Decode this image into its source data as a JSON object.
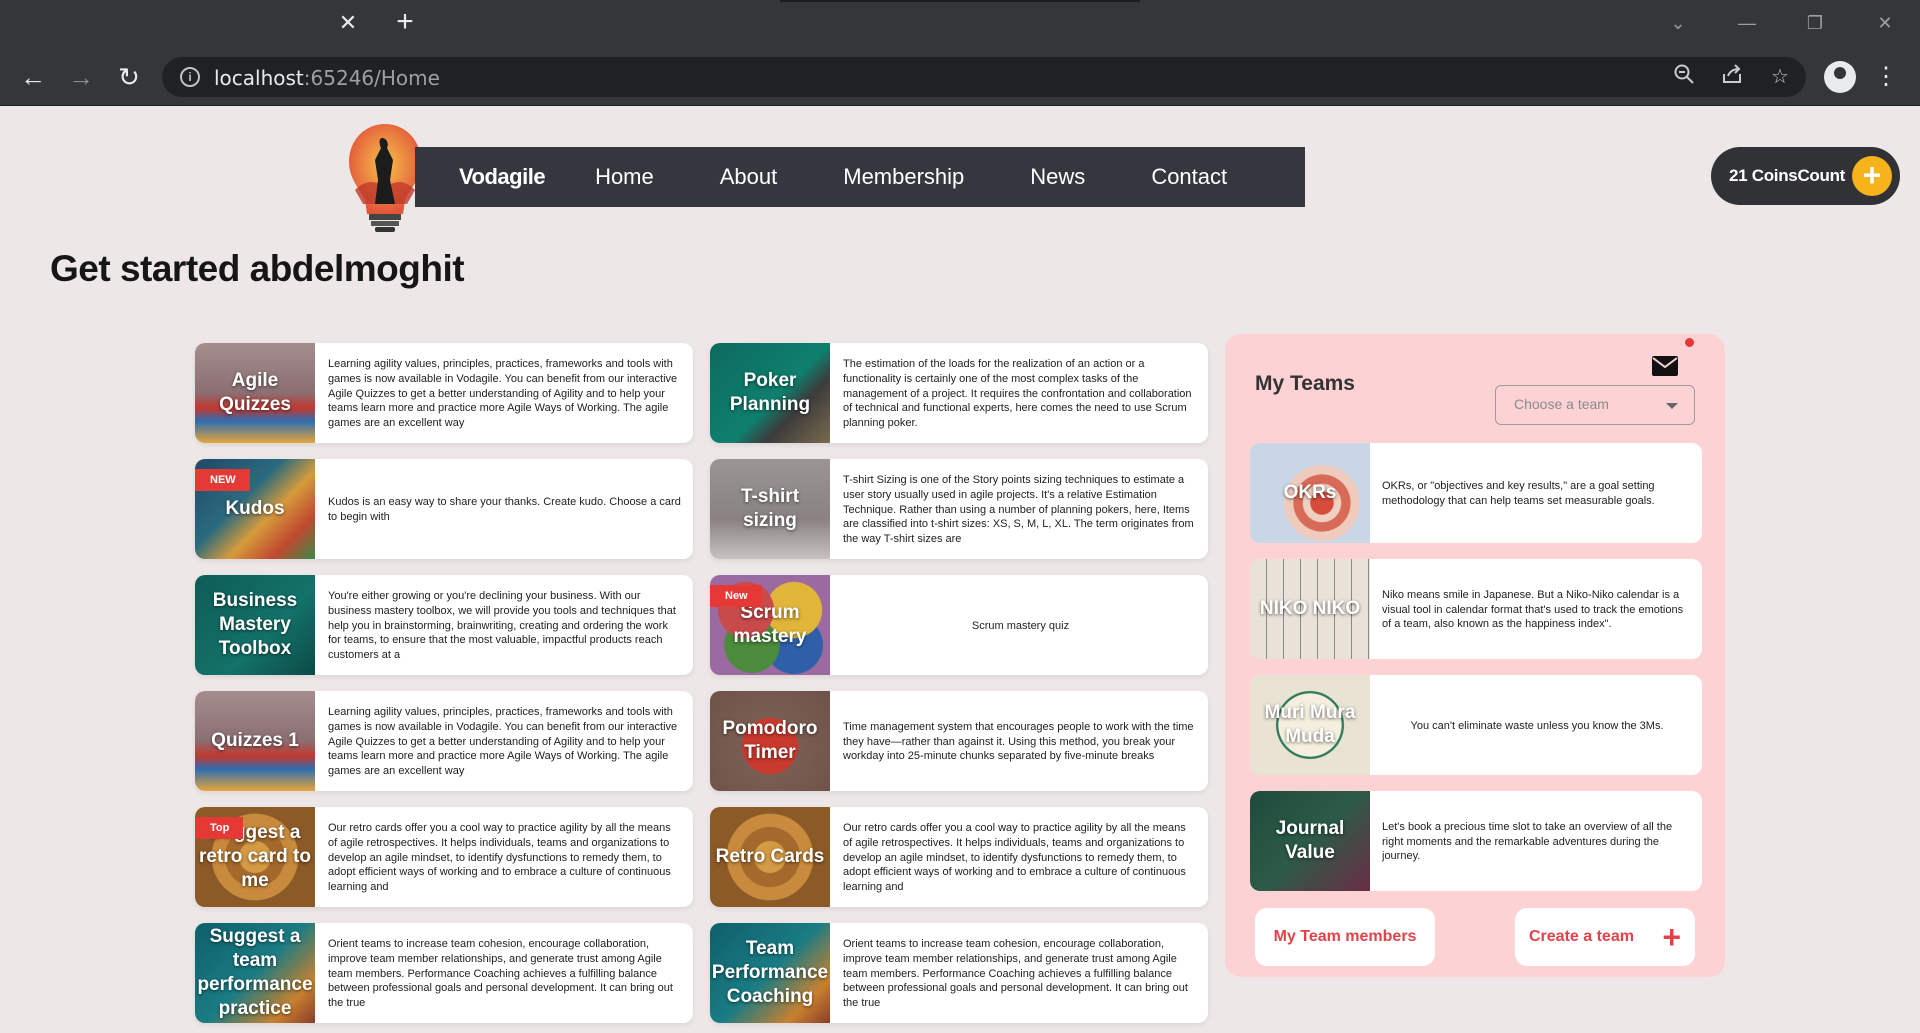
{
  "browser": {
    "url_host": "localhost",
    "url_rest": ":65246/Home",
    "tab_close": "✕",
    "tab_new": "+"
  },
  "nav": {
    "brand": "Vodagile",
    "links": [
      "Home",
      "About",
      "Membership",
      "News",
      "Contact"
    ]
  },
  "coins": {
    "label": "21 CoinsCount",
    "plus": "+"
  },
  "greeting": "Get started abdelmoghit",
  "cards": [
    {
      "title": "Agile Quizzes",
      "desc": "Learning agility values, principles, practices, frameworks and tools with games is now available in Vodagile. You can benefit from our interactive Agile Quizzes to get a better understanding of Agility and to help your teams learn more and practice more Agile Ways of Working. The agile games are an excellent way",
      "badge": ""
    },
    {
      "title": "Poker Planning",
      "desc": "The estimation of the loads for the realization of an action or a functionality is certainly one of the most complex tasks of the management of a project. It requires the confrontation and collaboration of technical and functional experts, here comes the need to use Scrum planning poker.",
      "badge": ""
    },
    {
      "title": "Kudos",
      "desc": "Kudos is an easy way to share your thanks. Create kudo. Choose a card to begin with",
      "badge": "NEW"
    },
    {
      "title": "T-shirt sizing",
      "desc": "T-shirt Sizing is one of the Story points sizing techniques to estimate a user story usually used in agile projects. It's a relative Estimation Technique. Rather than using a number of planning pokers, here, Items are classified into t-shirt sizes: XS, S, M, L, XL. The term originates from the way T-shirt sizes are",
      "badge": ""
    },
    {
      "title": "Business Mastery Toolbox",
      "desc": "You're either growing or you're declining your business. With our business mastery toolbox, we will provide you tools and techniques that help you in brainstorming, brainwriting, creating and ordering the work for teams, to ensure that the most valuable, impactful products reach customers at a",
      "badge": ""
    },
    {
      "title": "Scrum mastery",
      "desc": "Scrum mastery quiz",
      "badge": "New"
    },
    {
      "title": "Quizzes 1",
      "desc": "Learning agility values, principles, practices, frameworks and tools with games is now available in Vodagile. You can benefit from our interactive Agile Quizzes to get a better understanding of Agility and to help your teams learn more and practice more Agile Ways of Working. The agile games are an excellent way",
      "badge": ""
    },
    {
      "title": "Pomodoro Timer",
      "desc": "Time management system that encourages people to work with the time they have—rather than against it. Using this method, you break your workday into 25-minute chunks separated by five-minute breaks",
      "badge": ""
    },
    {
      "title": "Suggest a retro card to me",
      "desc": "Our retro cards offer you a cool way to practice agility by all the means of agile retrospectives. It helps individuals, teams and organizations to develop an agile mindset, to identify dysfunctions to remedy them, to adopt efficient ways of working and to embrace a culture of continuous learning and",
      "badge": "Top"
    },
    {
      "title": "Retro Cards",
      "desc": "Our retro cards offer you a cool way to practice agility by all the means of agile retrospectives. It helps individuals, teams and organizations to develop an agile mindset, to identify dysfunctions to remedy them, to adopt efficient ways of working and to embrace a culture of continuous learning and",
      "badge": ""
    },
    {
      "title": "Suggest a team performance practice",
      "desc": "Orient teams to increase team cohesion, encourage collaboration, improve team member relationships, and generate trust among Agile team members. Performance Coaching achieves a fulfilling balance between professional goals and personal development. It can bring out the true",
      "badge": ""
    },
    {
      "title": "Team Performance Coaching",
      "desc": "Orient teams to increase team cohesion, encourage collaboration, improve team member relationships, and generate trust among Agile team members. Performance Coaching achieves a fulfilling balance between professional goals and personal development. It can bring out the true",
      "badge": ""
    }
  ],
  "teams": {
    "title": "My Teams",
    "select_placeholder": "Choose a team",
    "items": [
      {
        "title": "OKRs",
        "desc": "OKRs, or \"objectives and key results,\" are a goal setting methodology that can help teams set measurable goals."
      },
      {
        "title": "NIKO NIKO",
        "desc": "Niko means smile in Japanese. But a Niko-Niko calendar is a visual tool in calendar format that's used to track the emotions of a team, also known as the happiness index\"."
      },
      {
        "title": "Muri Mura Muda",
        "desc": "You can't eliminate waste unless you know the 3Ms."
      },
      {
        "title": "Journal Value",
        "desc": "Let's book a precious time slot to take an overview of all the right moments and the remarkable adventures during the journey."
      }
    ],
    "members_button": "My Team members",
    "create_button": "Create a team",
    "create_plus": "+"
  }
}
